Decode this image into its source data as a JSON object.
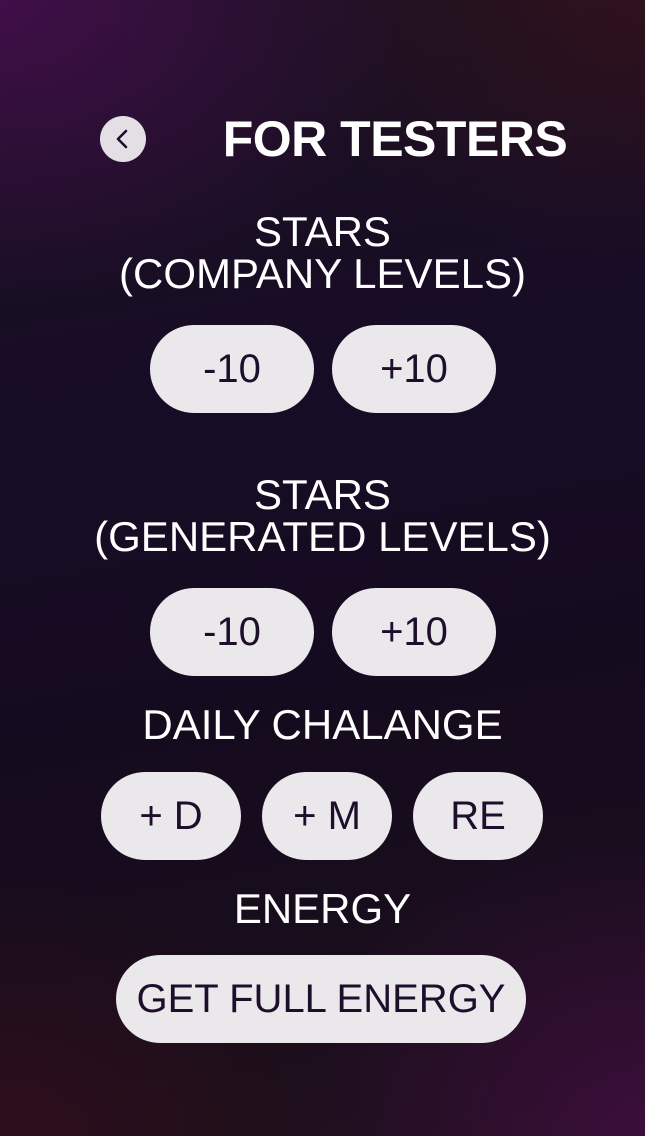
{
  "header": {
    "title": "FOR TESTERS",
    "back_icon": "chevron-left-icon"
  },
  "sections": {
    "company_stars": {
      "label_line1": "STARS",
      "label_line2": "(COMPANY LEVELS)",
      "minus_label": "-10",
      "plus_label": "+10"
    },
    "generated_stars": {
      "label_line1": "STARS",
      "label_line2": "(GENERATED LEVELS)",
      "minus_label": "-10",
      "plus_label": "+10"
    },
    "daily_challenge": {
      "label": "DAILY CHALANGE",
      "add_day_label": "+ D",
      "add_month_label": "+ M",
      "reset_label": "RE"
    },
    "energy": {
      "label": "ENERGY",
      "full_energy_label": "GET FULL ENERGY"
    }
  },
  "colors": {
    "button_bg": "#ebe8ec",
    "button_text": "#1d0f2c",
    "text": "#ffffff",
    "background_dark": "#150b1f",
    "accent_purple": "#460e50"
  }
}
